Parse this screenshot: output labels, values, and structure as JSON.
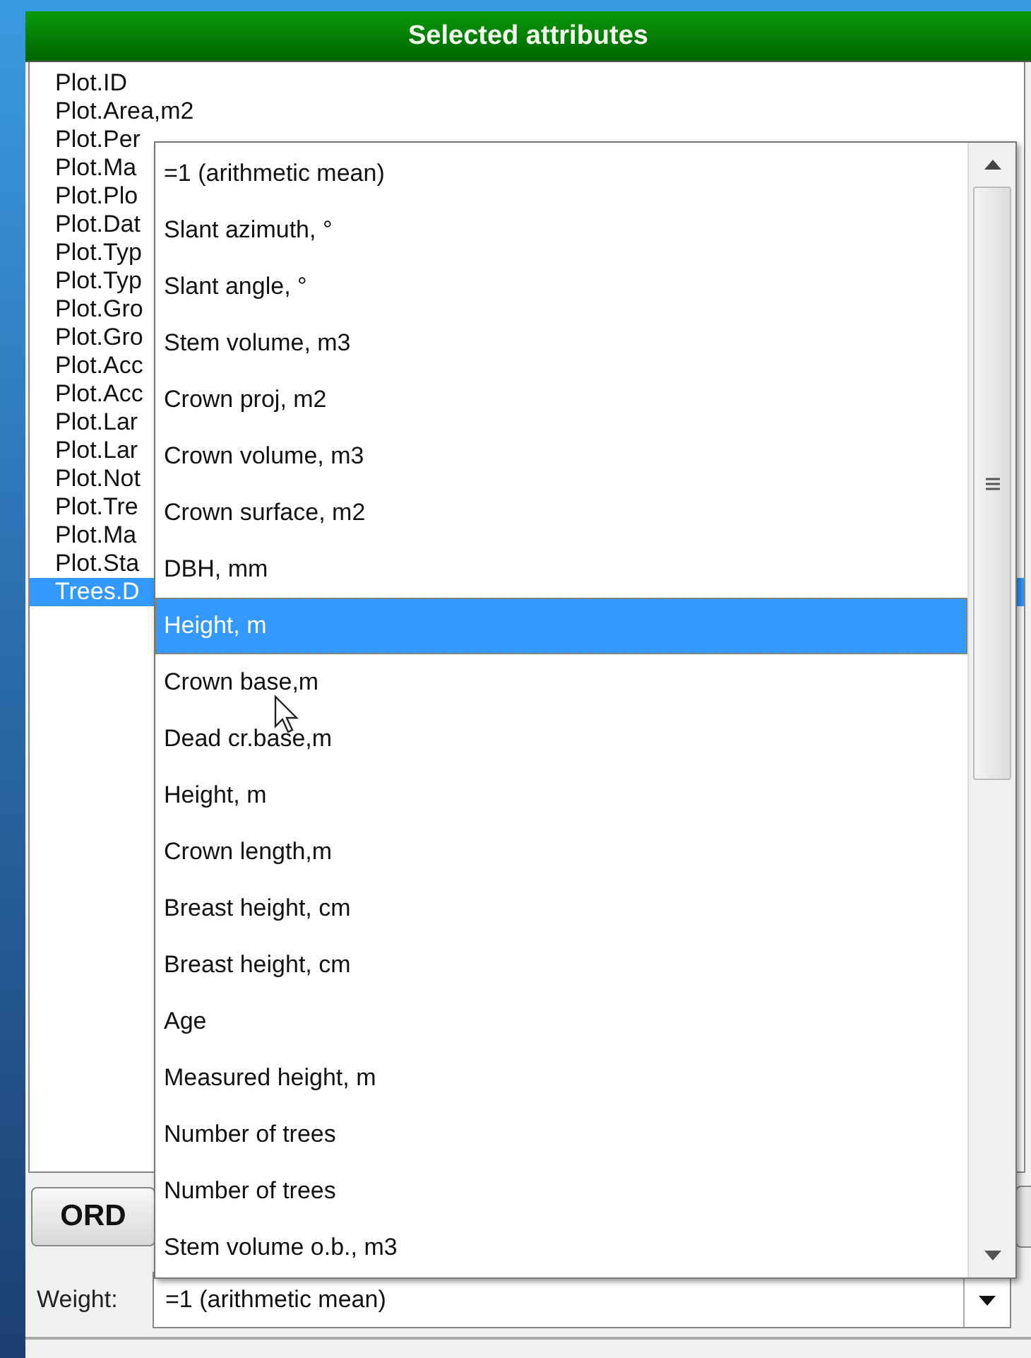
{
  "header": {
    "title": "Selected attributes"
  },
  "attributes": [
    {
      "label": "Plot.ID",
      "selected": false
    },
    {
      "label": "Plot.Area,m2",
      "selected": false
    },
    {
      "label": "Plot.Per",
      "selected": false
    },
    {
      "label": "Plot.Ma",
      "selected": false
    },
    {
      "label": "Plot.Plo",
      "selected": false
    },
    {
      "label": "Plot.Dat",
      "selected": false
    },
    {
      "label": "Plot.Typ",
      "selected": false
    },
    {
      "label": "Plot.Typ",
      "selected": false
    },
    {
      "label": "Plot.Gro",
      "selected": false
    },
    {
      "label": "Plot.Gro",
      "selected": false
    },
    {
      "label": "Plot.Acc",
      "selected": false
    },
    {
      "label": "Plot.Acc",
      "selected": false
    },
    {
      "label": "Plot.Lar",
      "selected": false
    },
    {
      "label": "Plot.Lar",
      "selected": false
    },
    {
      "label": "Plot.Not",
      "selected": false
    },
    {
      "label": "Plot.Tre",
      "selected": false
    },
    {
      "label": "Plot.Ma",
      "selected": false
    },
    {
      "label": "Plot.Sta",
      "selected": false
    },
    {
      "label": "Trees.D",
      "selected": true
    }
  ],
  "buttons": [
    {
      "label": "ORD"
    }
  ],
  "weight": {
    "label": "Weight:",
    "value": "=1 (arithmetic mean)",
    "expanded": true
  },
  "dropdown_options": [
    {
      "label": "=1 (arithmetic mean)",
      "selected": false
    },
    {
      "label": "Slant azimuth, °",
      "selected": false
    },
    {
      "label": "Slant angle, °",
      "selected": false
    },
    {
      "label": "Stem volume, m3",
      "selected": false
    },
    {
      "label": "Crown proj, m2",
      "selected": false
    },
    {
      "label": "Crown volume, m3",
      "selected": false
    },
    {
      "label": "Crown surface, m2",
      "selected": false
    },
    {
      "label": "DBH, mm",
      "selected": false
    },
    {
      "label": "Height, m",
      "selected": true
    },
    {
      "label": "Crown base,m",
      "selected": false
    },
    {
      "label": "Dead cr.base,m",
      "selected": false
    },
    {
      "label": "Height, m",
      "selected": false
    },
    {
      "label": "Crown length,m",
      "selected": false
    },
    {
      "label": "Breast height, cm",
      "selected": false
    },
    {
      "label": "Breast height, cm",
      "selected": false
    },
    {
      "label": "Age",
      "selected": false
    },
    {
      "label": "Measured height, m",
      "selected": false
    },
    {
      "label": "Number of trees",
      "selected": false
    },
    {
      "label": "Number of trees",
      "selected": false
    },
    {
      "label": "Stem volume o.b., m3",
      "selected": false
    }
  ]
}
